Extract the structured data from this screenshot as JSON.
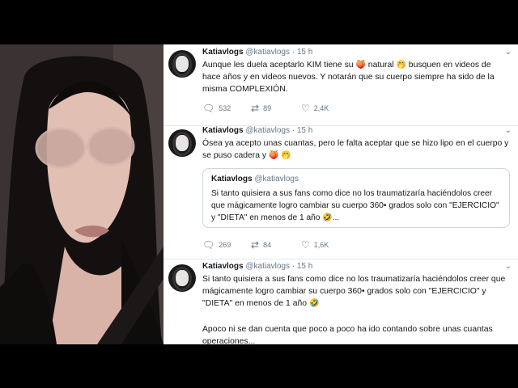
{
  "tweets": [
    {
      "name": "Katiavlogs",
      "handle": "@katiavlogs",
      "time": "· 15 h",
      "text_a": "Aunque les duela aceptarlo KIM tiene su ",
      "emoji_1": "🍑",
      "text_b": " natural ",
      "emoji_2": "🤭",
      "text_c": " busquen en videos de hace años y en videos nuevos. Y notarán que su cuerpo siempre ha sido de la misma COMPLEXIÓN.",
      "replies": "532",
      "retweets": "89",
      "likes": "2,4K"
    },
    {
      "name": "Katiavlogs",
      "handle": "@katiavlogs",
      "time": "· 15 h",
      "text_a": "Ósea ya acepto unas cuantas, pero le falta aceptar que se hizo lipo en el cuerpo y se puso cadera y ",
      "emoji_1": "🍑",
      "emoji_2": "🤭",
      "quote": {
        "name": "Katiavlogs",
        "handle": "@katiavlogs",
        "text": "Si tanto quisiera a sus fans como dice no los traumatizaría haciéndolos creer que mágicamente logro cambiar su cuerpo 360• grados solo con \"EJERCICIO\" y \"DIETA\" en menos de 1 año ",
        "emoji": "🤣",
        "ellipsis": "..."
      },
      "replies": "269",
      "retweets": "84",
      "likes": "1,6K"
    },
    {
      "name": "Katiavlogs",
      "handle": "@katiavlogs",
      "time": "· 15 h",
      "text_a": "Si tanto quisiera a sus fans como dice no los traumatizaría haciéndolos creer que mágicamente logro cambiar su cuerpo 360• grados solo con \"EJERCICIO\" y \"DIETA\" en menos de 1 año ",
      "emoji_1": "🤣",
      "text_b": "Apoco ni se dan cuenta que poco a poco ha ido contando sobre unas cuantas operaciones..."
    }
  ],
  "icons": {
    "reply": "reply-icon",
    "retweet": "retweet-icon",
    "like": "heart-icon",
    "menu": "chevron-down-icon"
  },
  "colors": {
    "text": "#14171a",
    "secondary": "#657786",
    "border": "#e1e8ed"
  }
}
